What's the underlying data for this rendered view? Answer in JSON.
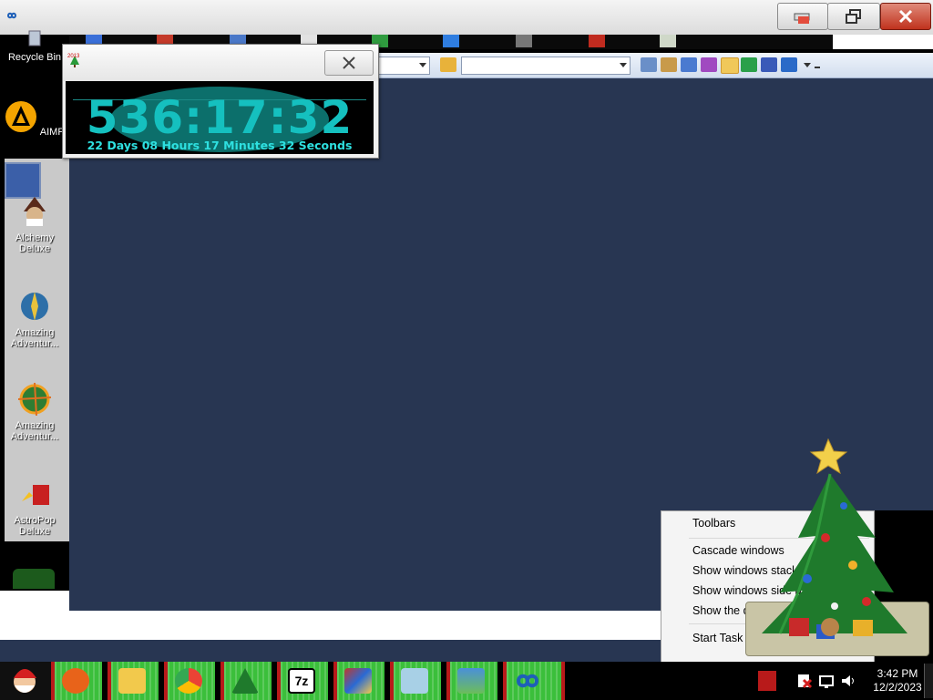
{
  "window": {
    "minimize_label": "",
    "restore_label": "",
    "close_label": ""
  },
  "desktop_icons": [
    {
      "label": "Recycle Bin"
    },
    {
      "label": "AIMP"
    },
    {
      "label": "Alchemy Deluxe"
    },
    {
      "label": "Amazing Adventur..."
    },
    {
      "label": "Amazing Adventur..."
    },
    {
      "label": "AstroPop Deluxe"
    }
  ],
  "countdown": {
    "icon_label": "2013",
    "time": "536:17:32",
    "detail": "22 Days 08 Hours 17 Minutes 32 Seconds"
  },
  "toolbar": {
    "combo1_value": "",
    "combo2_value": ""
  },
  "context_menu": {
    "items": [
      {
        "label": "Toolbars"
      },
      {
        "label": "Cascade windows"
      },
      {
        "label": "Show windows stacked"
      },
      {
        "label": "Show windows side by side"
      },
      {
        "label": "Show the desktop"
      },
      {
        "label": "Start Task Manager"
      }
    ]
  },
  "taskbar": {
    "apps": [
      {
        "name": "firefox-icon",
        "color": "#e8631a"
      },
      {
        "name": "file-explorer-icon",
        "color": "#f2c94c"
      },
      {
        "name": "chrome-icon",
        "color": "#34a853"
      },
      {
        "name": "christmas-tree-icon",
        "color": "#1f7a2c"
      },
      {
        "name": "7zip-icon",
        "color": "#ffffff"
      },
      {
        "name": "paint-icon",
        "color": "#c0392b"
      },
      {
        "name": "notepad-icon",
        "color": "#7fb3d5"
      },
      {
        "name": "photo-viewer-icon",
        "color": "#4a90d9"
      },
      {
        "name": "infinity-icon",
        "color": "#1e5fb8"
      }
    ],
    "time": "3:42 PM",
    "date": "12/2/2023"
  },
  "colors": {
    "main_bg": "#283652",
    "taskbar_item": "#3bbf3b",
    "countdown_text": "#15c0bf"
  }
}
